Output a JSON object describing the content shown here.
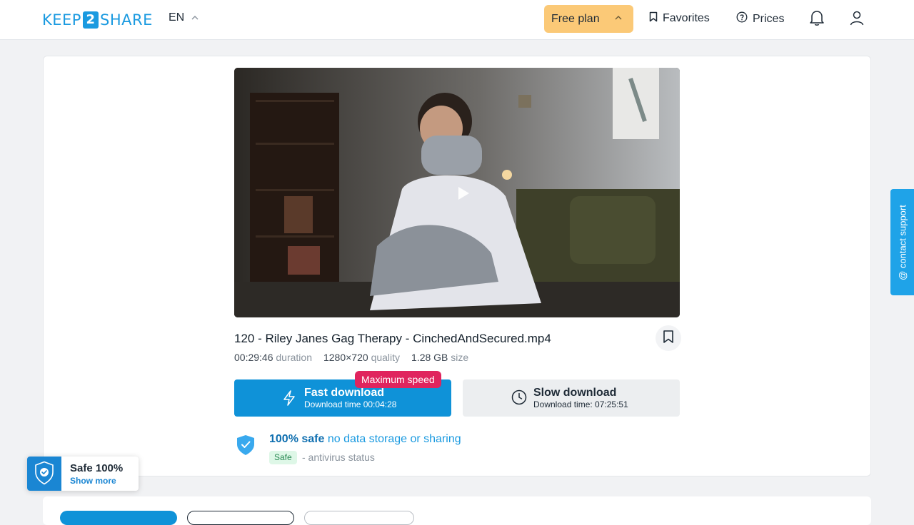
{
  "header": {
    "logo_left": "KEEP",
    "logo_mid": "2",
    "logo_right": "SHARE",
    "language": "EN",
    "plan_label": "Free plan",
    "favorites_label": "Favorites",
    "prices_label": "Prices",
    "icons": [
      "chevron-up-icon",
      "bookmark-icon",
      "help-circle-icon",
      "bell-icon",
      "user-icon"
    ]
  },
  "file": {
    "title": "120 - Riley Janes Gag Therapy - CinchedAndSecured.mp4",
    "duration_value": "00:29:46",
    "duration_label": "duration",
    "quality_value": "1280×720",
    "quality_label": "quality",
    "size_value": "1.28 GB",
    "size_label": "size"
  },
  "download": {
    "badge": "Maximum speed",
    "fast_label": "Fast download",
    "fast_time": "Download time 00:04:28",
    "slow_label": "Slow download",
    "slow_time": "Download time: 07:25:51"
  },
  "safety": {
    "strong": "100% safe",
    "rest": "no data storage or sharing",
    "badge": "Safe",
    "status": "- antivirus status"
  },
  "support_tab": "@ contact support",
  "popup": {
    "title": "Safe 100%",
    "link": "Show more"
  },
  "colors": {
    "brand": "#1a9ae0",
    "plan_button": "#fbc977",
    "fast_button": "#0f92d8",
    "badge_red": "#e0245e",
    "safe_green": "#2a8a54"
  }
}
